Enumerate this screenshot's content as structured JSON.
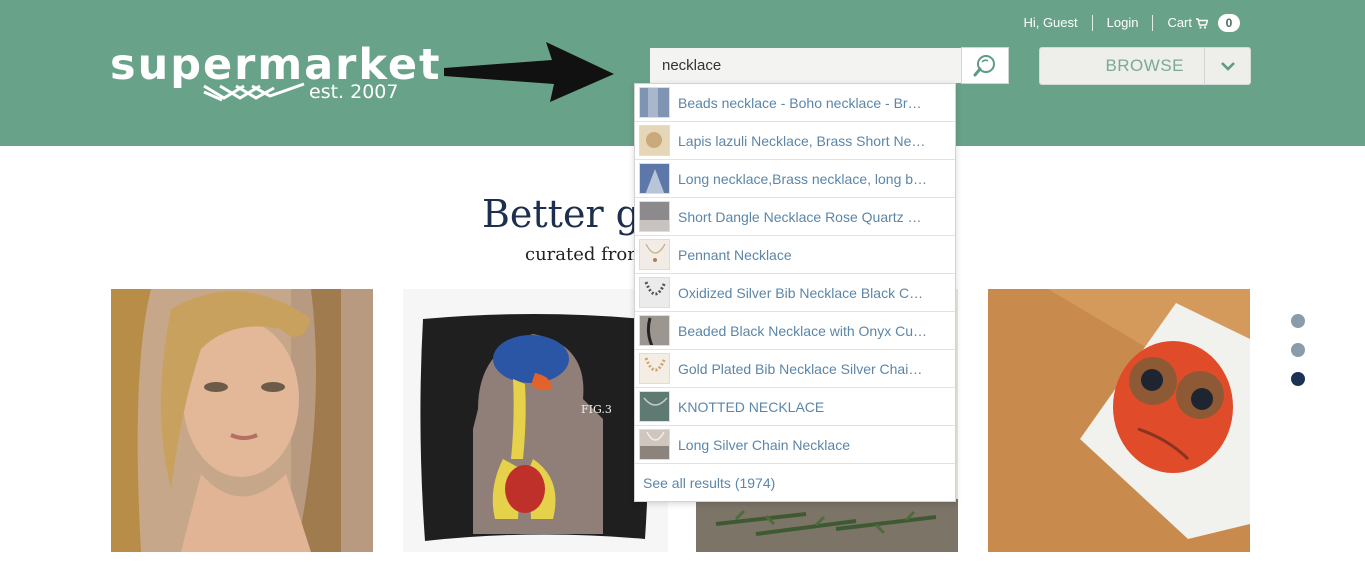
{
  "brand": {
    "name": "supermarket",
    "established": "est. 2007"
  },
  "topnav": {
    "greeting": "Hi, Guest",
    "login": "Login",
    "cart_label": "Cart",
    "cart_count": "0"
  },
  "search": {
    "value": "necklace",
    "button_icon": "search-icon"
  },
  "browse": {
    "label": "BROWSE",
    "toggle_icon": "chevron-down-icon"
  },
  "hero": {
    "title": "Better gif",
    "subtitle": "curated from"
  },
  "suggestions": [
    {
      "label": "Beads necklace - Boho necklace - Br…",
      "thumb_color": "#7f93b3"
    },
    {
      "label": "Lapis lazuli Necklace, Brass Short Ne…",
      "thumb_color": "#e6d6b8"
    },
    {
      "label": "Long necklace,Brass necklace, long b…",
      "thumb_color": "#5c77a8"
    },
    {
      "label": "Short Dangle Necklace Rose Quartz …",
      "thumb_color": "#8c8a8c"
    },
    {
      "label": "Pennant Necklace",
      "thumb_color": "#f2ece6"
    },
    {
      "label": "Oxidized Silver Bib Necklace Black C…",
      "thumb_color": "#ebebeb"
    },
    {
      "label": "Beaded Black Necklace with Onyx Cu…",
      "thumb_color": "#9c9690"
    },
    {
      "label": "Gold Plated Bib Necklace Silver Chai…",
      "thumb_color": "#f4ede4"
    },
    {
      "label": "KNOTTED NECKLACE",
      "thumb_color": "#5e7a73"
    },
    {
      "label": "Long Silver Chain Necklace",
      "thumb_color": "#cfc6bd"
    }
  ],
  "see_all": "See all results (1974)",
  "carousel": {
    "active_index": 2,
    "count": 3,
    "colors": {
      "inactive": "#8a9baa",
      "active": "#1d3355"
    }
  },
  "colors": {
    "header": "#68a289",
    "link": "#5b86a8",
    "title": "#1d2f4f"
  }
}
